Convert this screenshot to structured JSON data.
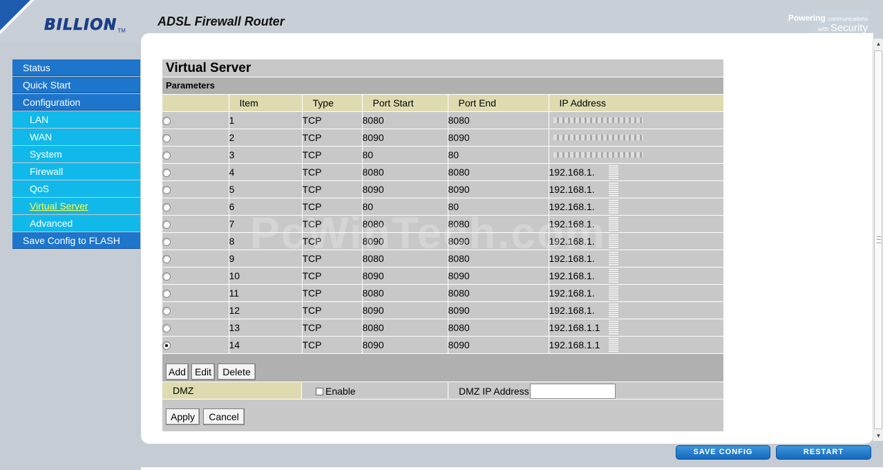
{
  "header": {
    "brand": "BILLION",
    "brand_tm": "TM",
    "product_title": "ADSL Firewall Router",
    "tagline_line1": "Powering",
    "tagline_line1_small": "communications",
    "tagline_line2": "with",
    "tagline_line2_big": "Security"
  },
  "menu": [
    {
      "label": "Status",
      "level": "top"
    },
    {
      "label": "Quick Start",
      "level": "top"
    },
    {
      "label": "Configuration",
      "level": "top"
    },
    {
      "label": "LAN",
      "level": "sub"
    },
    {
      "label": "WAN",
      "level": "sub"
    },
    {
      "label": "System",
      "level": "sub"
    },
    {
      "label": "Firewall",
      "level": "sub"
    },
    {
      "label": "QoS",
      "level": "sub"
    },
    {
      "label": "Virtual Server",
      "level": "sub",
      "active": true
    },
    {
      "label": "Advanced",
      "level": "sub"
    },
    {
      "label": "Save Config to FLASH",
      "level": "top"
    }
  ],
  "page": {
    "title": "Virtual Server",
    "section": "Parameters"
  },
  "table": {
    "columns": [
      "",
      "Item",
      "Type",
      "Port Start",
      "Port End",
      "IP Address"
    ],
    "rows": [
      {
        "item": "1",
        "type": "TCP",
        "port_start": "8080",
        "port_end": "8080",
        "ip": "",
        "selected": false
      },
      {
        "item": "2",
        "type": "TCP",
        "port_start": "8090",
        "port_end": "8090",
        "ip": "",
        "selected": false
      },
      {
        "item": "3",
        "type": "TCP",
        "port_start": "80",
        "port_end": "80",
        "ip": "",
        "selected": false
      },
      {
        "item": "4",
        "type": "TCP",
        "port_start": "8080",
        "port_end": "8080",
        "ip": "192.168.1.",
        "selected": false
      },
      {
        "item": "5",
        "type": "TCP",
        "port_start": "8090",
        "port_end": "8090",
        "ip": "192.168.1.",
        "selected": false
      },
      {
        "item": "6",
        "type": "TCP",
        "port_start": "80",
        "port_end": "80",
        "ip": "192.168.1.",
        "selected": false
      },
      {
        "item": "7",
        "type": "TCP",
        "port_start": "8080",
        "port_end": "8080",
        "ip": "192.168.1.",
        "selected": false
      },
      {
        "item": "8",
        "type": "TCP",
        "port_start": "8090",
        "port_end": "8090",
        "ip": "192.168.1.",
        "selected": false
      },
      {
        "item": "9",
        "type": "TCP",
        "port_start": "8080",
        "port_end": "8080",
        "ip": "192.168.1.",
        "selected": false
      },
      {
        "item": "10",
        "type": "TCP",
        "port_start": "8090",
        "port_end": "8090",
        "ip": "192.168.1.",
        "selected": false
      },
      {
        "item": "11",
        "type": "TCP",
        "port_start": "8080",
        "port_end": "8080",
        "ip": "192.168.1.",
        "selected": false
      },
      {
        "item": "12",
        "type": "TCP",
        "port_start": "8090",
        "port_end": "8090",
        "ip": "192.168.1.",
        "selected": false
      },
      {
        "item": "13",
        "type": "TCP",
        "port_start": "8080",
        "port_end": "8080",
        "ip": "192.168.1.1",
        "selected": false
      },
      {
        "item": "14",
        "type": "TCP",
        "port_start": "8090",
        "port_end": "8090",
        "ip": "192.168.1.1",
        "selected": true
      }
    ]
  },
  "buttons": {
    "add": "Add",
    "edit": "Edit",
    "delete": "Delete",
    "apply": "Apply",
    "cancel": "Cancel",
    "save_config": "SAVE CONFIG",
    "restart": "RESTART"
  },
  "dmz": {
    "label": "DMZ",
    "enable_label": "Enable",
    "enable_checked": false,
    "ip_label": "DMZ IP Address:",
    "ip_value": ""
  },
  "watermark": "PcWinTech.com",
  "colors": {
    "menu_top": "#1d75cc",
    "menu_sub": "#11b9ea",
    "menu_active_text": "#ffff44",
    "header_cell": "#dedbb0",
    "table_cell": "#c8c8c8"
  }
}
